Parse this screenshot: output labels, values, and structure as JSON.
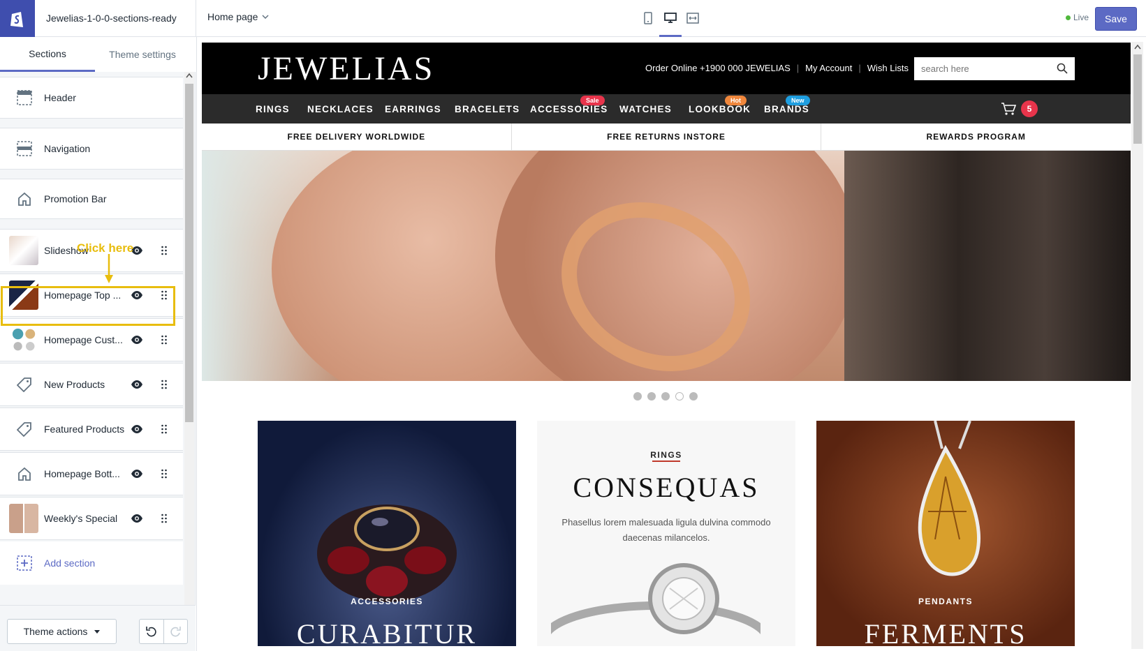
{
  "topbar": {
    "store_name": "Jewelias-1-0-0-sections-ready",
    "page_select": "Home page",
    "live_label": "Live",
    "save_label": "Save"
  },
  "sidebar": {
    "tabs": [
      "Sections",
      "Theme settings"
    ],
    "sections": [
      {
        "label": "Header",
        "icon": "header-icon"
      },
      {
        "label": "Navigation",
        "icon": "navigation-icon"
      },
      {
        "label": "Promotion Bar",
        "icon": "home-icon"
      },
      {
        "label": "Slideshow",
        "icon": "thumbnail"
      },
      {
        "label": "Homepage Top ...",
        "icon": "thumbnail"
      },
      {
        "label": "Homepage Cust...",
        "icon": "thumbnail"
      },
      {
        "label": "New Products",
        "icon": "tag-icon"
      },
      {
        "label": "Featured Products",
        "icon": "tag-icon"
      },
      {
        "label": "Homepage Bott...",
        "icon": "home-icon"
      },
      {
        "label": "Weekly's Special",
        "icon": "thumbnail"
      }
    ],
    "add_section": "Add section",
    "annotation": "Click here",
    "theme_actions": "Theme actions"
  },
  "site": {
    "brand": "JEWELIAS",
    "header_links": [
      "Order Online +1900 000 JEWELIAS",
      "My Account",
      "Wish Lists"
    ],
    "search_placeholder": "search here",
    "nav": [
      {
        "label": "RINGS",
        "badge": ""
      },
      {
        "label": "NECKLACES",
        "badge": ""
      },
      {
        "label": "EARRINGS",
        "badge": ""
      },
      {
        "label": "BRACELETS",
        "badge": ""
      },
      {
        "label": "ACCESSORIES",
        "badge": "Sale"
      },
      {
        "label": "WATCHES",
        "badge": ""
      },
      {
        "label": "LOOKBOOK",
        "badge": "Hot"
      },
      {
        "label": "BRANDS",
        "badge": "New"
      }
    ],
    "badge_colors": {
      "Sale": "#e8344b",
      "Hot": "#f0873c",
      "New": "#1e9ee0"
    },
    "cart_count": "5",
    "promo": [
      "FREE DELIVERY WORLDWIDE",
      "FREE RETURNS INSTORE",
      "REWARDS PROGRAM"
    ],
    "slideshow": {
      "total_slides": 5,
      "open_dot": 4
    },
    "cards": [
      {
        "label": "ACCESSORIES",
        "title": "CURABITUR",
        "description": ""
      },
      {
        "label": "RINGS",
        "title": "CONSEQUAS",
        "description": "Phasellus lorem malesuada ligula dulvina commodo daecenas milancelos."
      },
      {
        "label": "PENDANTS",
        "title": "FERMENTS",
        "description": ""
      }
    ]
  },
  "colors": {
    "accent": "#5c6ac4",
    "highlight": "#e8bd0e",
    "shopify_logo_bg": "#3f4eae"
  }
}
